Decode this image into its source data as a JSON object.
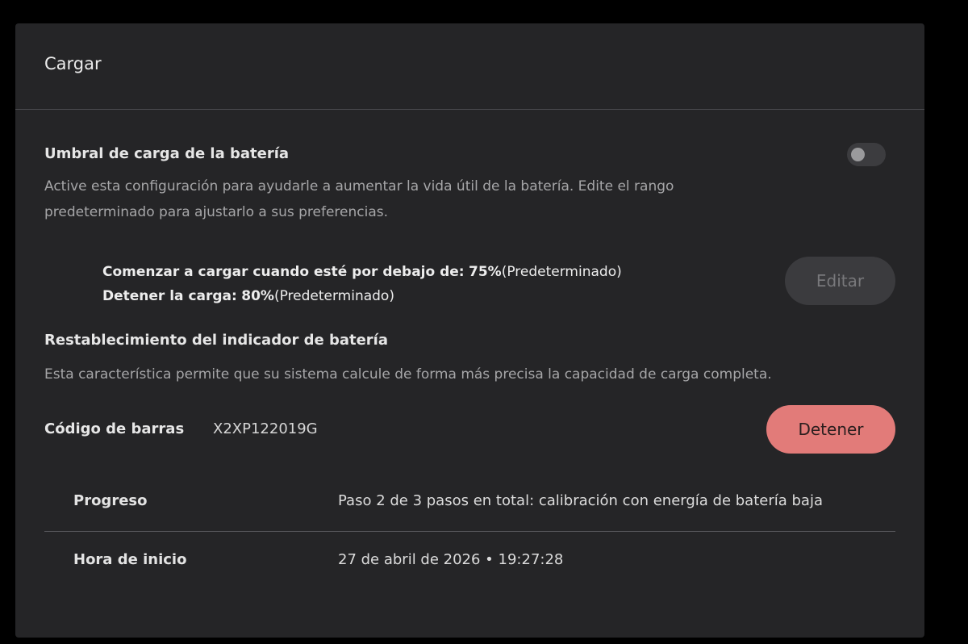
{
  "header": {
    "title": "Cargar"
  },
  "threshold": {
    "title": "Umbral de carga de la batería",
    "description_line1": "Active esta configuración para ayudarle a aumentar la vida útil de la batería. Edite el rango",
    "description_line2": "predeterminado para ajustarlo a sus preferencias.",
    "toggle_on": false,
    "start_label": "Comenzar a cargar cuando esté por debajo de:",
    "start_value": "75%",
    "start_suffix": "(Predeterminado)",
    "stop_label": "Detener la carga:",
    "stop_value": "80%",
    "stop_suffix": "(Predeterminado)",
    "edit_label": "Editar"
  },
  "reset": {
    "title": "Restablecimiento del indicador de batería",
    "description": "Esta característica permite que su sistema calcule de forma más precisa la capacidad de carga completa.",
    "barcode_label": "Código de barras",
    "barcode_value": "X2XP122019G",
    "stop_label": "Detener",
    "progress_label": "Progreso",
    "progress_value": "Paso 2 de 3 pasos en total: calibración con energía de batería baja",
    "start_time_label": "Hora de inicio",
    "start_time_value": "27 de abril de 2026 • 19:27:28"
  },
  "colors": {
    "panel": "#252527",
    "stop_button": "#e27b79",
    "edit_button": "#3b3b3e"
  }
}
